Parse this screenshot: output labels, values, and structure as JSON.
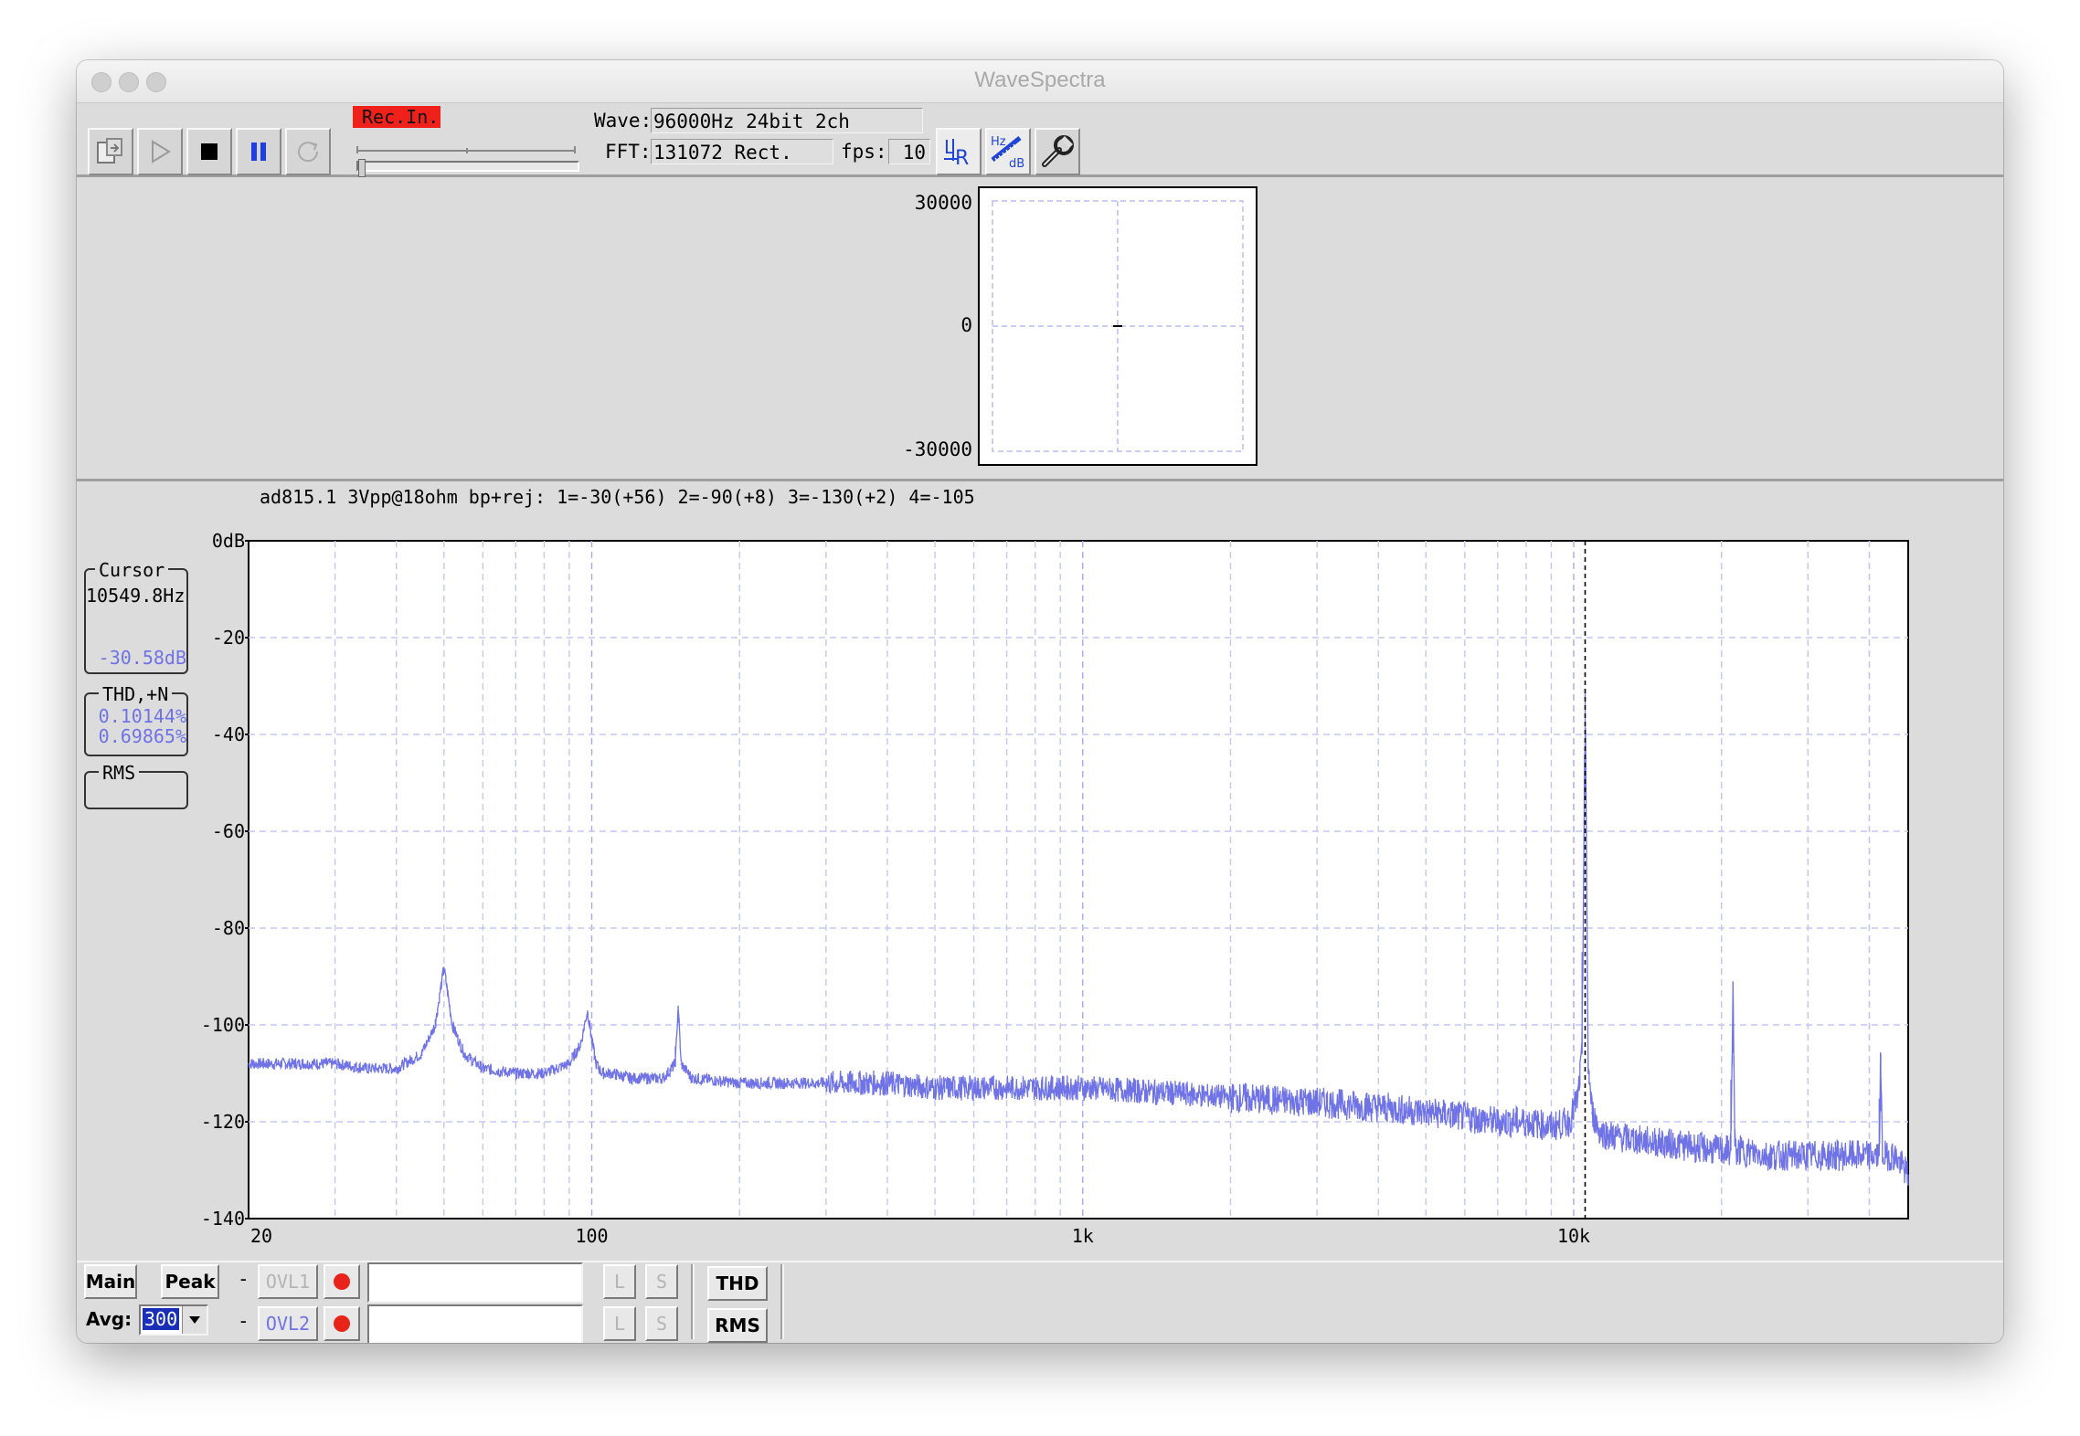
{
  "window": {
    "title": "WaveSpectra"
  },
  "toolbar": {
    "rec_in_label": "Rec.In.",
    "wave_label": "Wave:",
    "wave_value": "96000Hz 24bit 2ch",
    "fft_label": "FFT:",
    "fft_value": "131072 Rect.",
    "fps_label": "fps:",
    "fps_value": "10",
    "lr_button_label": "LR",
    "hzdb_button_label_top": "Hz",
    "hzdb_button_label_bottom": "dB",
    "buttons": [
      "export-icon",
      "play-icon",
      "stop-icon",
      "pause-icon",
      "loop-icon",
      "lr-icon",
      "hz-db-icon",
      "settings-wrench-icon"
    ]
  },
  "lissajous": {
    "y_top": "30000",
    "y_mid": "0",
    "y_bottom": "-30000"
  },
  "spectrum": {
    "annotation": "ad815.1 3Vpp@18ohm bp+rej: 1=-30(+56) 2=-90(+8) 3=-130(+2) 4=-105",
    "cursor": {
      "title": "Cursor",
      "freq": "10549.8Hz",
      "level": "-30.58dB"
    },
    "thd": {
      "title": "THD,+N",
      "thd": "0.10144%",
      "thdn": "0.69865%"
    },
    "rms": {
      "title": "RMS"
    },
    "trace_color": "#6f73e6"
  },
  "chart_data": {
    "type": "line",
    "title": "",
    "xlabel": "",
    "ylabel": "",
    "x_scale": "log",
    "xlim": [
      20,
      48000
    ],
    "ylim": [
      -140,
      0
    ],
    "x_ticks": [
      "20",
      "100",
      "1k",
      "10k"
    ],
    "y_ticks": [
      "0dB",
      "-20",
      "-40",
      "-60",
      "-80",
      "-100",
      "-120",
      "-140"
    ],
    "grid": true,
    "cursor_x": 10549.8,
    "series": [
      {
        "x": [
          20,
          25,
          30,
          35,
          40,
          45,
          48,
          50,
          52,
          55,
          60,
          70,
          80,
          90,
          95,
          98,
          100,
          102,
          105,
          110,
          120,
          140,
          148,
          150,
          152,
          160,
          200,
          300,
          400,
          500,
          600,
          800,
          1000,
          1500,
          2000,
          3000,
          4000,
          5000,
          6000,
          7000,
          8000,
          9000,
          9800,
          10200,
          10400,
          10549.8,
          10700,
          10900,
          11300,
          12000,
          14000,
          17000,
          20000,
          20900,
          21100,
          21300,
          22000,
          25000,
          30000,
          35000,
          40000,
          41900,
          42200,
          42500,
          45000,
          48000
        ],
        "y": [
          -108,
          -108,
          -108,
          -109,
          -109,
          -106,
          -100,
          -88,
          -100,
          -106,
          -109,
          -110,
          -110,
          -108,
          -104,
          -97,
          -103,
          -108,
          -110,
          -110,
          -111,
          -111,
          -108,
          -96,
          -108,
          -111,
          -112,
          -112,
          -112,
          -113,
          -113,
          -113,
          -113,
          -114,
          -115,
          -116,
          -117,
          -118,
          -119,
          -120,
          -120,
          -121,
          -120,
          -115,
          -106,
          -30.6,
          -108,
          -118,
          -122,
          -123,
          -124,
          -125,
          -126,
          -126,
          -91,
          -126,
          -126,
          -127,
          -127,
          -127,
          -127,
          -127,
          -106,
          -127,
          -127,
          -131
        ]
      }
    ]
  },
  "bottom": {
    "main_label": "Main",
    "peak_label": "Peak",
    "dash": "-",
    "ovl1_label": "OVL1",
    "ovl2_label": "OVL2",
    "l_label": "L",
    "s_label": "S",
    "thd_label": "THD",
    "rms_label": "RMS",
    "avg_label": "Avg:",
    "avg_value": "300",
    "ovl1_field": "",
    "ovl2_field": ""
  }
}
